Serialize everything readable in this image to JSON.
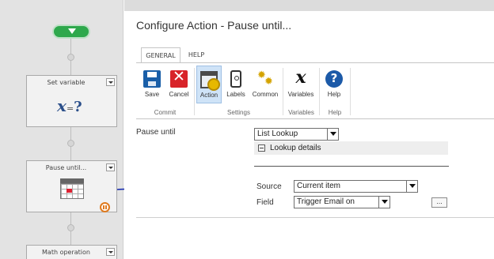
{
  "workflow": {
    "actions": [
      {
        "title": "Set variable",
        "icon": "set-variable-icon"
      },
      {
        "title": "Pause until...",
        "icon": "pause-until-icon"
      },
      {
        "title": "Math operation",
        "icon": "math-operation-icon"
      }
    ]
  },
  "dialog": {
    "title": "Configure Action - Pause until...",
    "tabs": [
      {
        "label": "GENERAL",
        "active": true
      },
      {
        "label": "HELP",
        "active": false
      }
    ],
    "ribbon": {
      "buttons": [
        {
          "label": "Save",
          "icon": "save-icon"
        },
        {
          "label": "Cancel",
          "icon": "cancel-icon",
          "glyph": "✕"
        },
        {
          "label": "Action",
          "icon": "action-icon",
          "active": true
        },
        {
          "label": "Labels",
          "icon": "labels-icon"
        },
        {
          "label": "Common",
          "icon": "common-icon",
          "glyph": "✹"
        },
        {
          "label": "Variables",
          "icon": "variables-icon",
          "glyph": "x"
        },
        {
          "label": "Help",
          "icon": "help-icon",
          "glyph": "?"
        }
      ],
      "groups": [
        {
          "label": "Commit"
        },
        {
          "label": "Settings"
        },
        {
          "label": "Variables"
        },
        {
          "label": "Help"
        }
      ]
    },
    "form": {
      "pause_until_label": "Pause until",
      "pause_until_value": "List Lookup",
      "lookup_details_label": "Lookup details",
      "source_label": "Source",
      "source_value": "Current item",
      "field_label": "Field",
      "field_value": "Trigger Email on",
      "ellipsis_label": "..."
    }
  },
  "colors": {
    "canvas_bg": "#e3e3e3",
    "start_green": "#2ea84c",
    "ribbon_active": "#cfe3f7",
    "annotation_blue": "#1a2fb0"
  }
}
